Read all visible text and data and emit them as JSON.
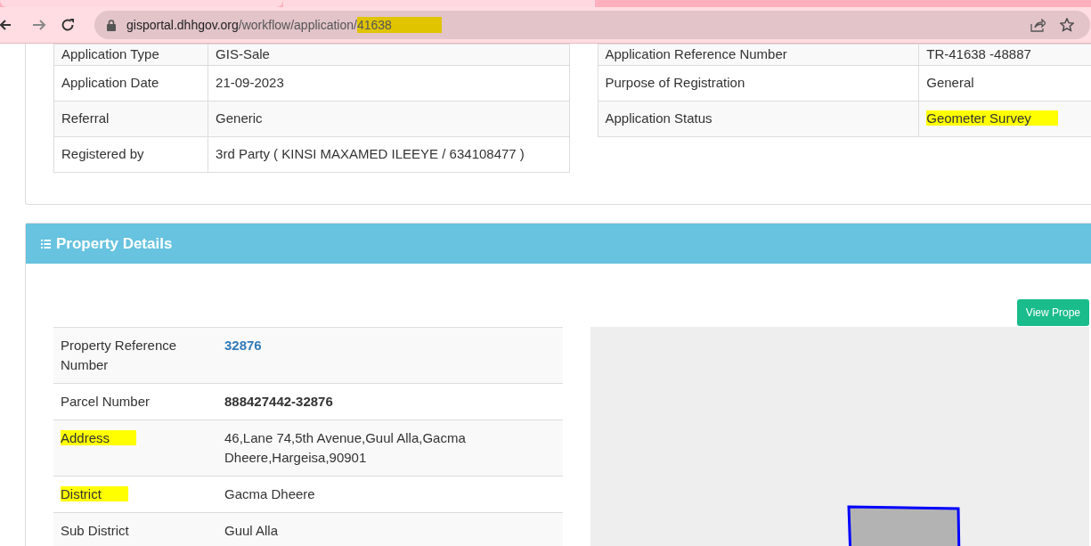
{
  "browser": {
    "url": {
      "host": "gisportal.dhhgov.org",
      "path": "/workflow/application/",
      "highlight": "41638"
    }
  },
  "application": {
    "left_rows": [
      {
        "label": "Application Type",
        "value": "GIS-Sale",
        "label_highlighted": false,
        "value_highlighted": false
      },
      {
        "label": "Application Date",
        "value": "21-09-2023",
        "label_highlighted": false,
        "value_highlighted": false
      },
      {
        "label": "Referral",
        "value": "Generic",
        "label_highlighted": false,
        "value_highlighted": false
      },
      {
        "label": "Registered by",
        "value": "3rd Party ( KINSI MAXAMED ILEEYE / 634108477 )",
        "label_highlighted": false,
        "value_highlighted": false
      }
    ],
    "right_rows": [
      {
        "label": "Application Reference Number",
        "value": "TR-41638 -48887",
        "label_highlighted": false,
        "value_highlighted": false
      },
      {
        "label": "Purpose of Registration",
        "value": "General",
        "label_highlighted": false,
        "value_highlighted": false
      },
      {
        "label": "Application Status",
        "value": "Geometer Survey",
        "label_highlighted": false,
        "value_highlighted": true
      }
    ]
  },
  "property": {
    "title": "Property Details",
    "button": "View Prope",
    "rows": [
      {
        "label": "Property Reference Number",
        "value": "32876",
        "kind": "link",
        "label_highlighted": false
      },
      {
        "label": "Parcel Number",
        "value": "888427442-32876",
        "kind": "bold",
        "label_highlighted": false
      },
      {
        "label": "Address",
        "value": "46,Lane 74,5th Avenue,Guul Alla,Gacma Dheere,Hargeisa,90901",
        "kind": "text",
        "label_highlighted": true
      },
      {
        "label": "District",
        "value": "Gacma Dheere",
        "kind": "text",
        "label_highlighted": true
      },
      {
        "label": "Sub District",
        "value": "Guul Alla",
        "kind": "text",
        "label_highlighted": false
      }
    ]
  }
}
